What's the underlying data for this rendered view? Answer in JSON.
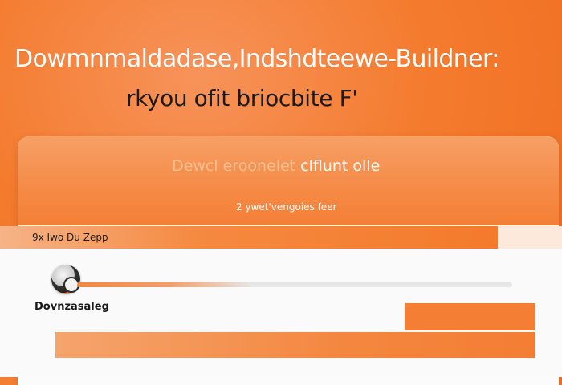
{
  "hero": {
    "title": "Dowmnmaldadase,Indshdteewe-Buildner:",
    "subtitle": "rkyou ofit briocbite F'"
  },
  "card": {
    "header_title_dim": "Dewcl eroonelet",
    "header_title_main": "clflunt olle",
    "header_subtitle": "2 ywet'vengoies feer"
  },
  "strip": {
    "label": "9x Iwo Du Zepp"
  },
  "download": {
    "label": "Dovnzasaleg",
    "progress_fraction": 0.4
  },
  "colors": {
    "accent": "#f47f34",
    "background": "#f47b2e",
    "card": "#fbfbfb"
  },
  "icons": {
    "app": "app-disc-icon"
  }
}
